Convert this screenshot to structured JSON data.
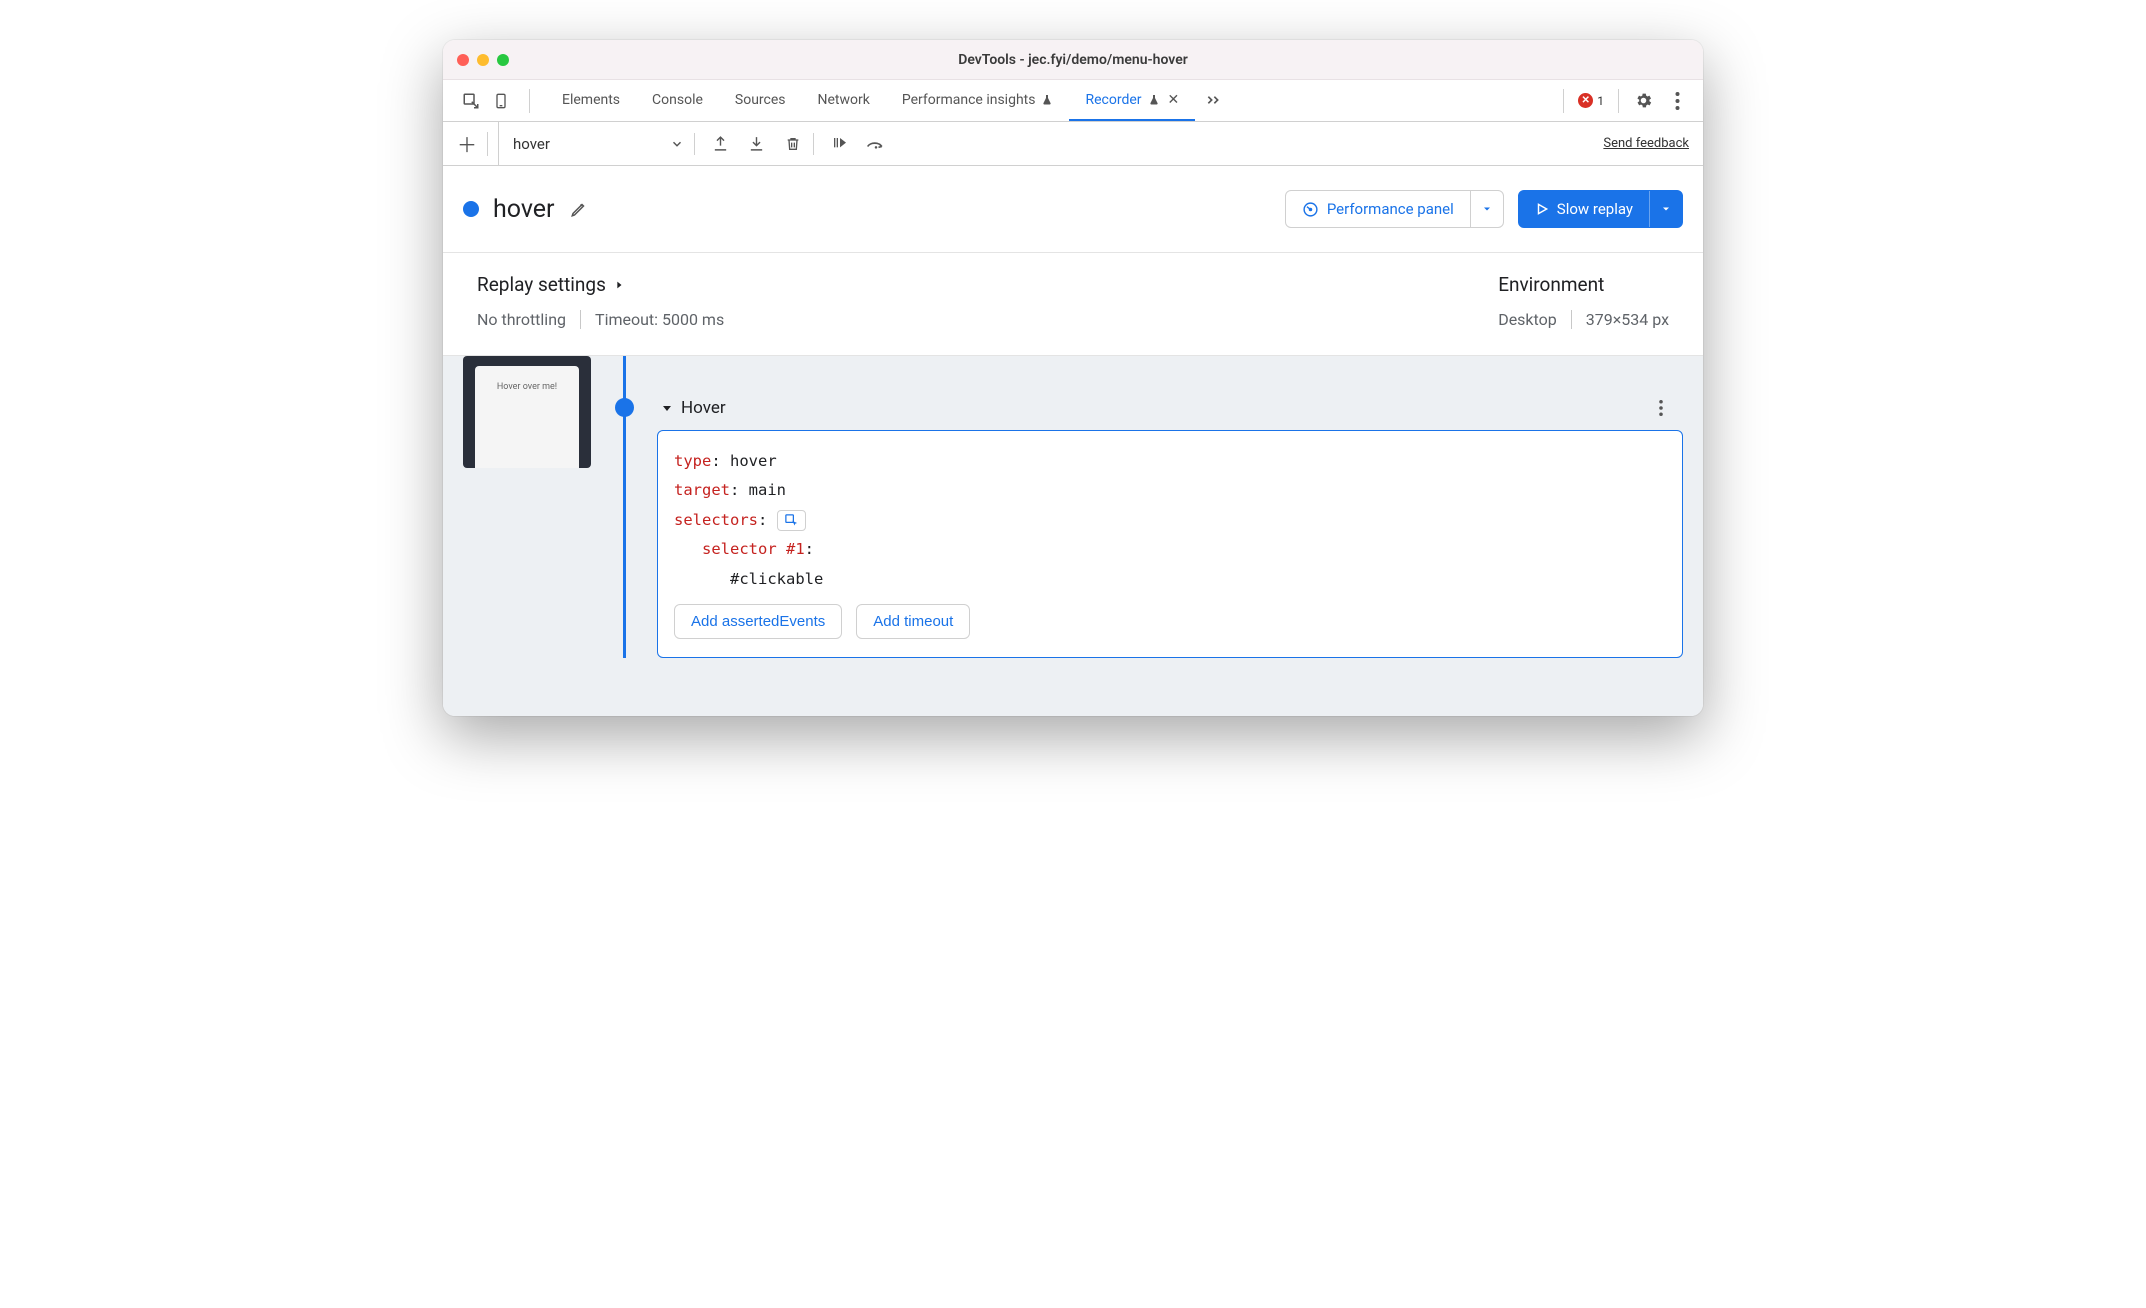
{
  "window": {
    "title": "DevTools - jec.fyi/demo/menu-hover"
  },
  "tabs": {
    "items": [
      {
        "label": "Elements",
        "active": false
      },
      {
        "label": "Console",
        "active": false
      },
      {
        "label": "Sources",
        "active": false
      },
      {
        "label": "Network",
        "active": false
      },
      {
        "label": "Performance insights",
        "active": false,
        "experimental": true
      },
      {
        "label": "Recorder",
        "active": true,
        "experimental": true,
        "closable": true
      }
    ],
    "error_count": "1"
  },
  "toolbar": {
    "recording_selected": "hover",
    "feedback_label": "Send feedback"
  },
  "recording": {
    "name": "hover",
    "performance_btn": "Performance panel",
    "replay_btn": "Slow replay"
  },
  "settings": {
    "replay_heading": "Replay settings",
    "throttling": "No throttling",
    "timeout": "Timeout: 5000 ms",
    "env_heading": "Environment",
    "device": "Desktop",
    "viewport": "379×534 px"
  },
  "thumbnail": {
    "caption": "Hover over me!"
  },
  "step": {
    "title": "Hover",
    "props": {
      "type_key": "type",
      "type_val": "hover",
      "target_key": "target",
      "target_val": "main",
      "selectors_key": "selectors",
      "selector1_key": "selector #1",
      "selector1_val": "#clickable"
    },
    "add_asserted": "Add assertedEvents",
    "add_timeout": "Add timeout"
  }
}
